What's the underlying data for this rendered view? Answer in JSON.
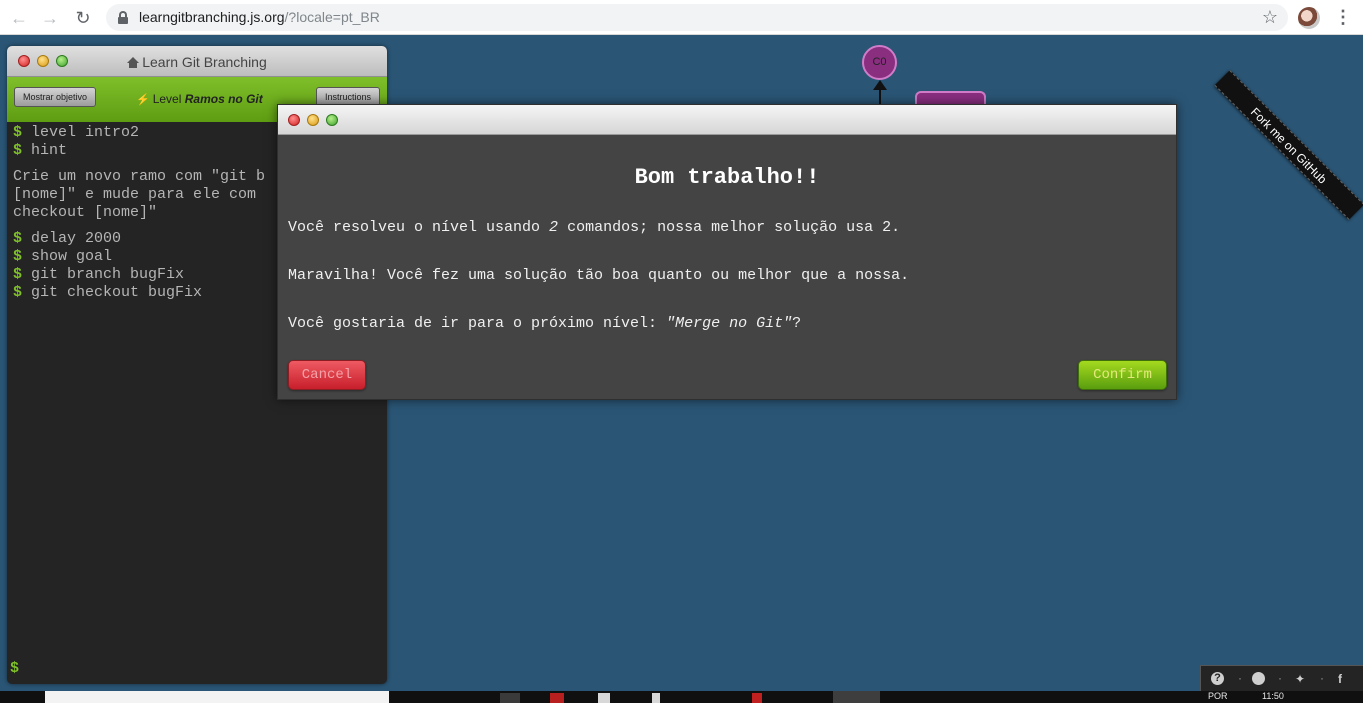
{
  "browser": {
    "url_host": "learngitbranching.js.org",
    "url_rest": "/?locale=pt_BR"
  },
  "terminal": {
    "title": "Learn Git Branching",
    "objective_button": "Mostrar objetivo",
    "instructions_button": "Instructions",
    "level_prefix": "Level",
    "level_name": "Ramos no Git",
    "prompt_symbol": "$",
    "commands_before": [
      "level intro2",
      "hint"
    ],
    "hint_message": "Crie um novo ramo com \"git b\n[nome]\" e mude para ele com \ncheckout [nome]\"",
    "commands_after": [
      "delay 2000",
      "show goal",
      "git branch bugFix",
      "git checkout bugFix"
    ]
  },
  "graph": {
    "node_label": "C0"
  },
  "fork_ribbon": "Fork me on GitHub",
  "dialog": {
    "heading": "Bom trabalho!!",
    "line1_a": "Você resolveu o nível usando ",
    "line1_count": "2",
    "line1_b": " comandos; nossa melhor solução usa 2.",
    "line2": "Maravilha! Você fez uma solução tão boa quanto ou melhor que a nossa.",
    "line3_a": "Você gostaria de ir para o próximo nível: ",
    "line3_level": "\"Merge no Git\"",
    "line3_b": "?",
    "cancel_label": "Cancel",
    "confirm_label": "Confirm"
  },
  "social_bar": {
    "help": "?",
    "separator": "·",
    "facebook": "f"
  },
  "taskbar": {
    "tray_lang": "POR",
    "tray_time": "11:50"
  }
}
